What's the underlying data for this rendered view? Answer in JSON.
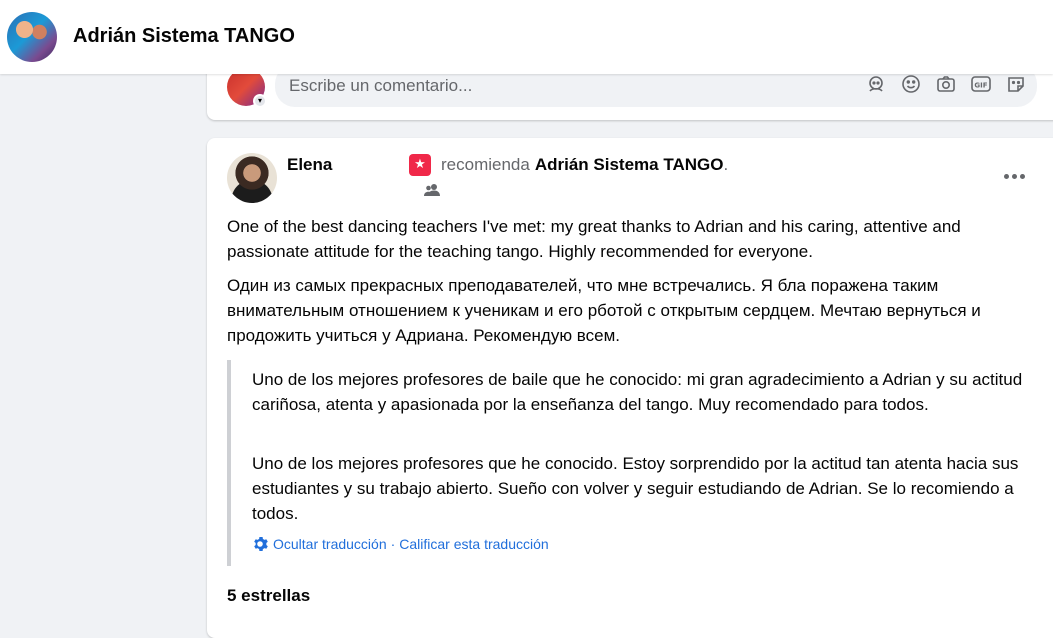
{
  "header": {
    "page_name": "Adrián Sistema TANGO"
  },
  "composer": {
    "placeholder": "Escribe un comentario...",
    "icons": [
      "avatar-sticker-icon",
      "emoji-icon",
      "camera-icon",
      "gif-icon",
      "sticker-icon"
    ]
  },
  "post": {
    "author": "Elena",
    "recommends_text": "recomienda",
    "target": "Adrián Sistema TANGO",
    "target_suffix": ".",
    "audience": "friends-icon",
    "body_en": "One of the best dancing teachers I've met: my great thanks to Adrian and his caring, attentive and passionate attitude for the teaching tango. Highly recommended for everyone.",
    "body_ru": "Один из самых прекрасных преподавателей, что мне встречались. Я бла поражена таким внимательным отношением к ученикам и его рботой с открытым сердцем. Мечтаю вернуться и продожить учиться у Адриана. Рекомендую всем.",
    "translation": {
      "t1": "Uno de los mejores profesores de baile que he conocido: mi gran agradecimiento a Adrian y su actitud cariñosa, atenta y apasionada por la enseñanza del tango. Muy recomendado para todos.",
      "t2": "Uno de los mejores profesores que he conocido. Estoy sorprendido por la actitud tan atenta hacia sus estudiantes y su trabajo abierto. Sueño con volver y seguir estudiando de Adrian. Se lo recomiendo a todos.",
      "hide_label": "Ocultar traducción",
      "separator": "·",
      "rate_label": "Calificar esta traducción"
    },
    "rating": "5 estrellas"
  },
  "colors": {
    "link": "#216fdb",
    "recommend_badge": "#f02849",
    "background": "#f0f2f5"
  }
}
